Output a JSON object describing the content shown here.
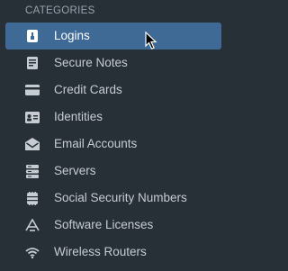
{
  "sidebar": {
    "section_title": "CATEGORIES",
    "items": [
      {
        "label": "Logins",
        "icon": "login-key-icon",
        "selected": true
      },
      {
        "label": "Secure Notes",
        "icon": "note-icon",
        "selected": false
      },
      {
        "label": "Credit Cards",
        "icon": "credit-card-icon",
        "selected": false
      },
      {
        "label": "Identities",
        "icon": "id-card-icon",
        "selected": false
      },
      {
        "label": "Email Accounts",
        "icon": "envelope-open-icon",
        "selected": false
      },
      {
        "label": "Servers",
        "icon": "server-icon",
        "selected": false
      },
      {
        "label": "Social Security Numbers",
        "icon": "ssn-icon",
        "selected": false
      },
      {
        "label": "Software Licenses",
        "icon": "software-license-icon",
        "selected": false
      },
      {
        "label": "Wireless Routers",
        "icon": "wifi-icon",
        "selected": false
      }
    ]
  },
  "colors": {
    "background": "#272f37",
    "selected_background": "#3f6a96",
    "text": "#c7ccd2",
    "section_title": "#9aa3ad",
    "selected_text": "#ffffff"
  }
}
